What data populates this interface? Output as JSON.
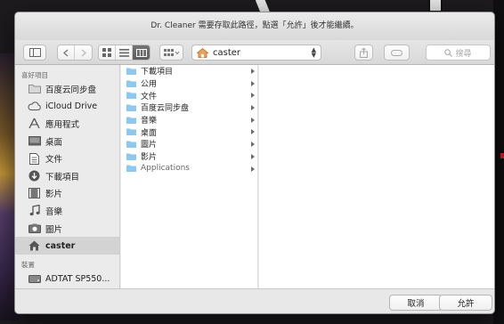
{
  "window": {
    "title": "Dr. Cleaner 需要存取此路徑，點選「允許」後才能繼續。"
  },
  "toolbar": {
    "path_label": "caster",
    "search_placeholder": "搜尋"
  },
  "sidebar": {
    "favorites_header": "喜好項目",
    "favorites": [
      {
        "label": "百度云同步盘",
        "icon": "folder-icon"
      },
      {
        "label": "iCloud Drive",
        "icon": "cloud-icon"
      },
      {
        "label": "應用程式",
        "icon": "applications-icon"
      },
      {
        "label": "桌面",
        "icon": "desktop-icon"
      },
      {
        "label": "文件",
        "icon": "documents-icon"
      },
      {
        "label": "下載項目",
        "icon": "downloads-icon"
      },
      {
        "label": "影片",
        "icon": "movies-icon"
      },
      {
        "label": "音樂",
        "icon": "music-icon"
      },
      {
        "label": "圖片",
        "icon": "pictures-icon"
      },
      {
        "label": "caster",
        "icon": "home-icon",
        "selected": true
      }
    ],
    "devices_header": "裝置",
    "devices": [
      {
        "label": "ADTAT SP550...",
        "icon": "drive-icon"
      }
    ]
  },
  "browser": {
    "column1": [
      {
        "label": "下載項目"
      },
      {
        "label": "公用"
      },
      {
        "label": "文件"
      },
      {
        "label": "百度云同步盘"
      },
      {
        "label": "音樂"
      },
      {
        "label": "桌面"
      },
      {
        "label": "圖片"
      },
      {
        "label": "影片"
      },
      {
        "label": "Applications"
      }
    ]
  },
  "footer": {
    "cancel_label": "取消",
    "allow_label": "允許"
  },
  "colors": {
    "folder": "#8cc8f0",
    "selection": "#d3d3d3"
  }
}
